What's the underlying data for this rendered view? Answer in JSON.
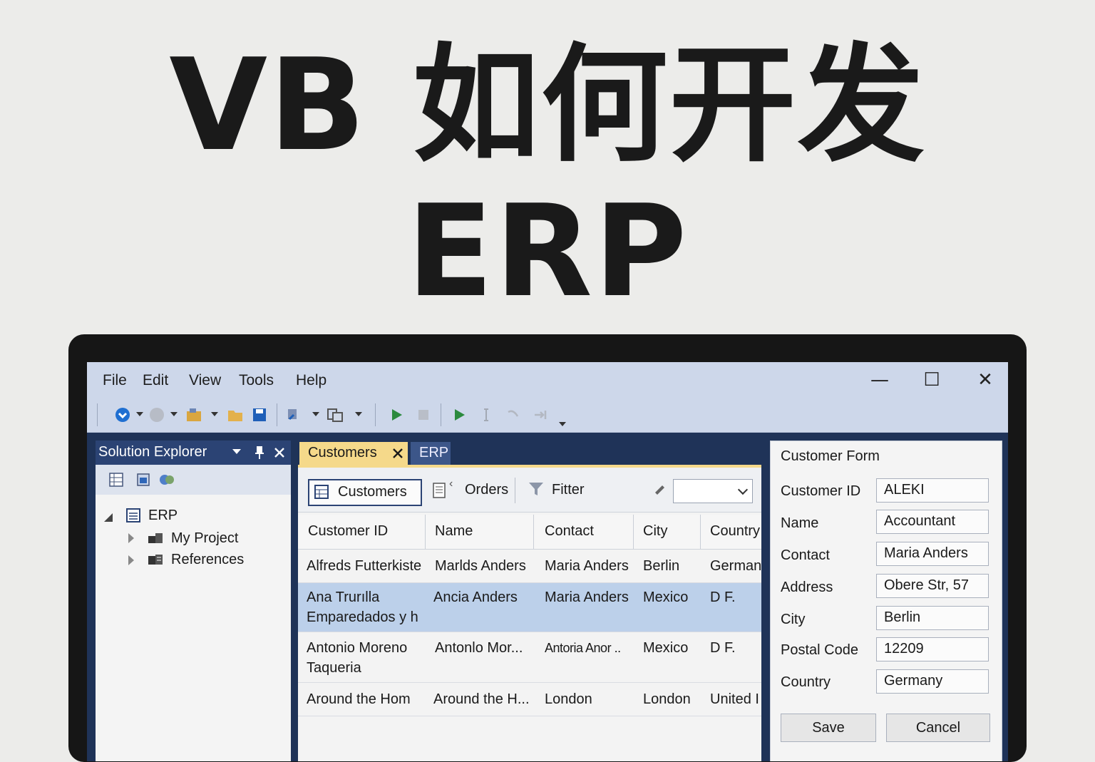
{
  "headline": {
    "line1": "VB 如何开发",
    "line2": "ERP"
  },
  "menu": {
    "file": "File",
    "edit": "Edit",
    "view": "View",
    "tools": "Tools",
    "help": "Help"
  },
  "window_controls": {
    "minimize": "—",
    "maximize": "☐",
    "close": "✕"
  },
  "solution_explorer": {
    "title": "Solution Explorer",
    "tree": {
      "root": "ERP",
      "children": [
        "My Project",
        "References"
      ]
    }
  },
  "tabs": {
    "active": "Customers",
    "inactive": "ERP"
  },
  "doc_toolbar": {
    "customers": "Customers",
    "orders": "Orders",
    "filter": "Fitter"
  },
  "grid": {
    "columns": [
      "Customer ID",
      "Name",
      "Contact",
      "City",
      "Country"
    ],
    "rows": [
      {
        "id": "Alfreds Futterkiste",
        "name": "Marlds Anders",
        "contact": "Maria Anders",
        "city": "Berlin",
        "country": "German"
      },
      {
        "id": "Ana Trurılla Emparedados y h",
        "id_l1": "Ana Trurılla",
        "id_l2": "Emparedados y h",
        "name": "Ancia Anders",
        "contact": "Maria Anders",
        "city": "Mexico",
        "country": "D F."
      },
      {
        "id": "Antonio Moreno Taqueria",
        "id_l1": "Antonio Moreno",
        "id_l2": "Taqueria",
        "name": "Antonlo Mor...",
        "contact": "Antoria Anor ..",
        "city": "Mexico",
        "country": "D F."
      },
      {
        "id": "Around the Hom",
        "name": "Around the H...",
        "contact": "London",
        "city": "London",
        "country": "United I"
      }
    ]
  },
  "form": {
    "title": "Customer Form",
    "fields": [
      {
        "label": "Customer ID",
        "value": "ALEKI"
      },
      {
        "label": "Name",
        "value": "Accountant"
      },
      {
        "label": "Contact",
        "value": "Maria Anders"
      },
      {
        "label": "Address",
        "value": "Obere Str, 57"
      },
      {
        "label": "City",
        "value": "Berlin"
      },
      {
        "label": "Postal Code",
        "value": "12209"
      },
      {
        "label": "Country",
        "value": "Germany"
      }
    ],
    "save": "Save",
    "cancel": "Cancel"
  },
  "colors": {
    "accent": "#2b4374",
    "tab_active": "#f5d98a",
    "selected_row": "#bcd0ea"
  }
}
